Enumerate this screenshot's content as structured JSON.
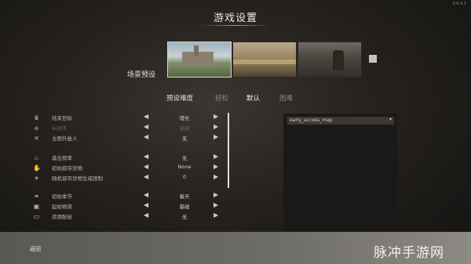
{
  "header": {
    "version": "0.9.4.1",
    "title": "游戏设置"
  },
  "scene": {
    "label": "场景预设",
    "presets": [
      {
        "name": "castle-scene",
        "selected": true
      },
      {
        "name": "fields-scene",
        "selected": false
      },
      {
        "name": "rider-scene",
        "selected": false
      }
    ]
  },
  "difficulty": {
    "label": "预设难度",
    "options": [
      "轻松",
      "默认",
      "困难"
    ],
    "active": "默认"
  },
  "settings": [
    {
      "icon": "trophy-icon",
      "name": "结束目标",
      "value": "增长",
      "dim": false
    },
    {
      "icon": "ai-icon",
      "name": "AI对手",
      "value": "关闭",
      "dim": true
    },
    {
      "icon": "crossed-swords-icon",
      "name": "全图外敌人",
      "value": "无",
      "dim": false
    },
    {
      "icon": "flame-icon",
      "name": "袭击频率",
      "value": "无",
      "dim": false
    },
    {
      "icon": "hand-icon",
      "name": "初始掠夺货物",
      "value": "None",
      "dim": false
    },
    {
      "icon": "bolt-icon",
      "name": "随机掠夺货物生成限制",
      "value": "0",
      "dim": false
    },
    {
      "icon": "leaf-icon",
      "name": "初始季节",
      "value": "春天",
      "dim": false
    },
    {
      "icon": "flag-icon",
      "name": "起始物资",
      "value": "基础",
      "dim": false
    },
    {
      "icon": "box-icon",
      "name": "资源配给",
      "value": "无",
      "dim": false
    }
  ],
  "map": {
    "selected": "early_access_map"
  },
  "footer": {
    "back_label": "返回"
  },
  "watermark": "脉冲手游网",
  "colors": {
    "accent": "#e2ddd3",
    "bottom_bar": "#6f6d69"
  }
}
